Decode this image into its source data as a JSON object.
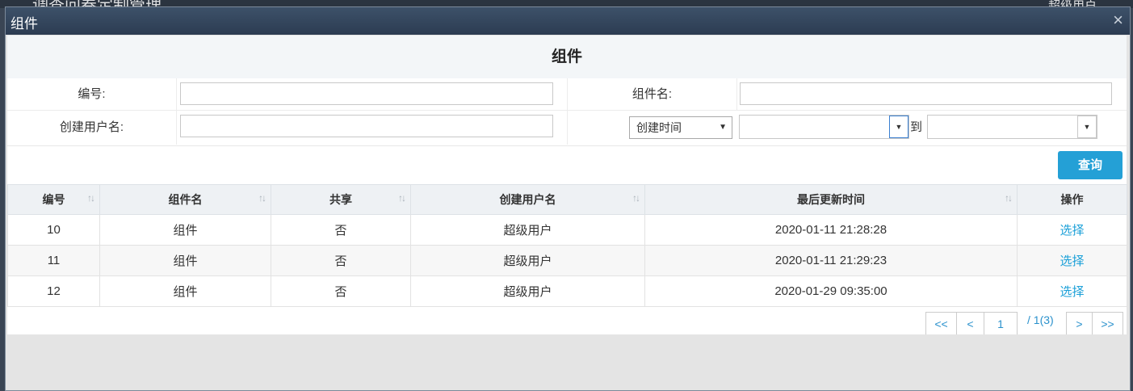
{
  "background": {
    "app_title": "调查问卷定制管理",
    "user": "超级用户"
  },
  "modal": {
    "title": "组件",
    "close": "×"
  },
  "panel": {
    "title": "组件"
  },
  "filters": {
    "id_label": "编号:",
    "name_label": "组件名:",
    "creator_label": "创建用户名:",
    "date_field": "创建时间",
    "to_label": "到",
    "query_button": "查询"
  },
  "table": {
    "headers": [
      "编号",
      "组件名",
      "共享",
      "创建用户名",
      "最后更新时间",
      "操作"
    ],
    "rows": [
      {
        "id": "10",
        "name": "组件",
        "shared": "否",
        "creator": "超级用户",
        "updated": "2020-01-11 21:28:28",
        "action": "选择"
      },
      {
        "id": "11",
        "name": "组件",
        "shared": "否",
        "creator": "超级用户",
        "updated": "2020-01-11 21:29:23",
        "action": "选择"
      },
      {
        "id": "12",
        "name": "组件",
        "shared": "否",
        "creator": "超级用户",
        "updated": "2020-01-29 09:35:00",
        "action": "选择"
      }
    ]
  },
  "pagination": {
    "first": "<<",
    "prev": "<",
    "current": "1",
    "info": "/ 1(3)",
    "next": ">",
    "last": ">>"
  }
}
